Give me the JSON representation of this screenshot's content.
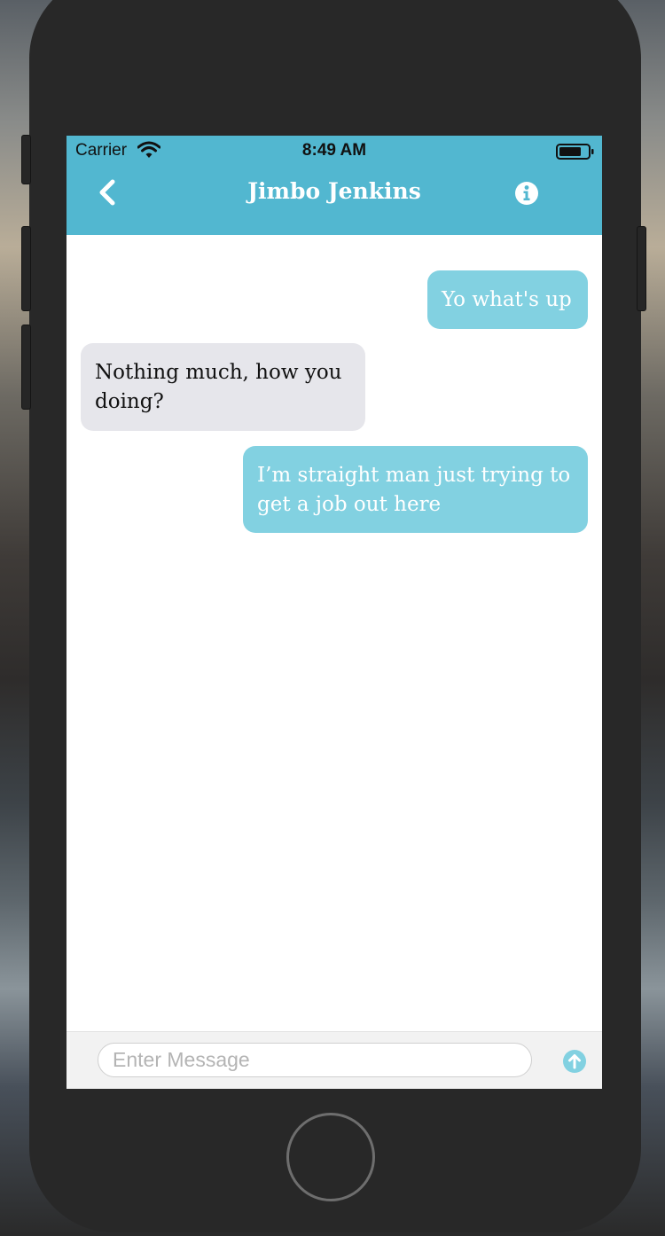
{
  "status_bar": {
    "carrier": "Carrier",
    "time": "8:49 AM",
    "wifi_icon": "wifi-icon",
    "battery_icon": "battery-icon"
  },
  "navbar": {
    "back_icon": "chevron-left-icon",
    "title": "Jimbo Jenkins",
    "info_icon": "info-circle-icon",
    "color": "#52b7d0"
  },
  "messages": [
    {
      "direction": "outgoing",
      "text": "Yo what's up"
    },
    {
      "direction": "incoming",
      "text": "Nothing much, how you doing?"
    },
    {
      "direction": "outgoing",
      "text": "I’m straight man just trying to get a job out here"
    }
  ],
  "composer": {
    "placeholder": "Enter Message",
    "value": "",
    "send_icon": "arrow-up-circle-icon"
  },
  "colors": {
    "outgoing_bubble": "#82d1e1",
    "incoming_bubble": "#e6e6eb",
    "accent": "#52b7d0"
  }
}
